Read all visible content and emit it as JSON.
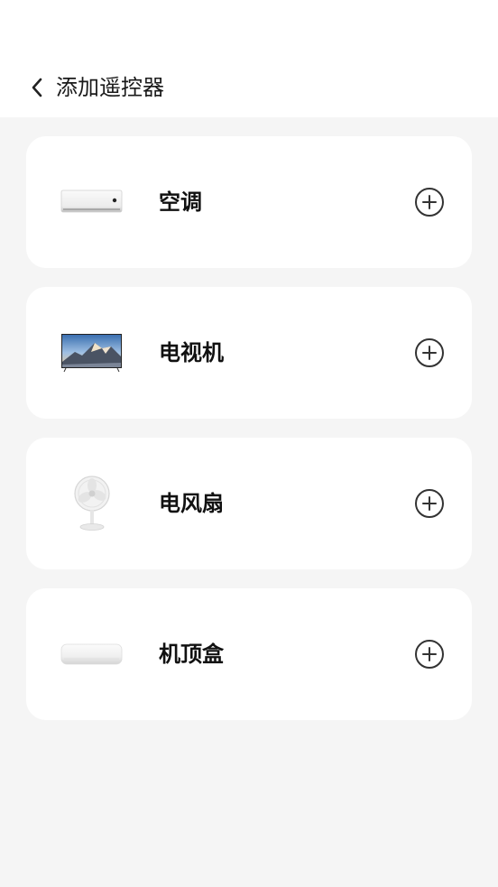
{
  "header": {
    "title": "添加遥控器",
    "back_icon": "chevron-left-icon"
  },
  "devices": [
    {
      "label": "空调",
      "image": "air-conditioner-image",
      "action_icon": "plus-circle-icon"
    },
    {
      "label": "电视机",
      "image": "television-image",
      "action_icon": "plus-circle-icon"
    },
    {
      "label": "电风扇",
      "image": "electric-fan-image",
      "action_icon": "plus-circle-icon"
    },
    {
      "label": "机顶盒",
      "image": "set-top-box-image",
      "action_icon": "plus-circle-icon"
    }
  ],
  "colors": {
    "page_background": "#f5f5f5",
    "card_background": "#ffffff",
    "text": "#111111",
    "icon_stroke": "#333333"
  }
}
